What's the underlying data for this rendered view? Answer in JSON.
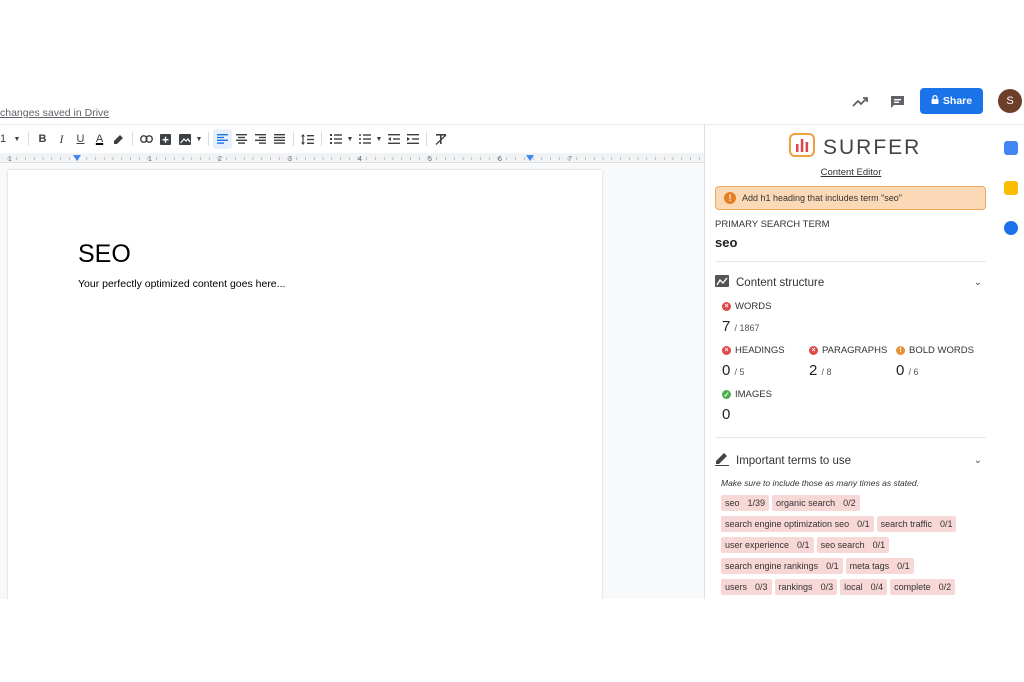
{
  "topbar": {
    "saved_text": "changes saved in Drive",
    "share_label": "Share",
    "avatar_initial": "S"
  },
  "toolbar": {
    "zoom_fragment": "1",
    "bold": "B",
    "italic": "I",
    "underline": "U",
    "text_color": "A"
  },
  "ruler": {
    "marks": [
      "1",
      "1",
      "2",
      "3",
      "4",
      "5",
      "6",
      "7"
    ]
  },
  "document": {
    "title": "SEO",
    "body": "Your perfectly optimized content goes here..."
  },
  "surfer": {
    "logo_text": "SURFER",
    "content_editor_link": "Content Editor",
    "alert": "Add h1 heading that includes term \"seo\"",
    "primary_search_term_label": "PRIMARY SEARCH TERM",
    "primary_search_term": "seo",
    "content_structure": {
      "title": "Content structure",
      "words": {
        "label": "WORDS",
        "value": "7",
        "target": "/ 1867",
        "status": "red"
      },
      "headings": {
        "label": "HEADINGS",
        "value": "0",
        "target": "/ 5",
        "status": "red"
      },
      "paragraphs": {
        "label": "PARAGRAPHS",
        "value": "2",
        "target": "/ 8",
        "status": "red"
      },
      "bold_words": {
        "label": "BOLD WORDS",
        "value": "0",
        "target": "/ 6",
        "status": "orange"
      },
      "images": {
        "label": "IMAGES",
        "value": "0",
        "status": "green"
      }
    },
    "important_terms": {
      "title": "Important terms to use",
      "hint": "Make sure to include those as many times as stated.",
      "rows": [
        [
          {
            "term": "seo",
            "count": "1/39"
          },
          {
            "term": "organic search",
            "count": "0/2"
          }
        ],
        [
          {
            "term": "search engine optimization seo",
            "count": "0/1"
          },
          {
            "term": "search traffic",
            "count": "0/1"
          }
        ],
        [
          {
            "term": "user experience",
            "count": "0/1"
          },
          {
            "term": "seo search",
            "count": "0/1"
          }
        ],
        [
          {
            "term": "search engine rankings",
            "count": "0/1"
          },
          {
            "term": "meta tags",
            "count": "0/1"
          }
        ],
        [
          {
            "term": "users",
            "count": "0/3"
          },
          {
            "term": "rankings",
            "count": "0/3"
          },
          {
            "term": "local",
            "count": "0/4"
          },
          {
            "term": "complete",
            "count": "0/2"
          }
        ]
      ]
    }
  },
  "colors": {
    "share_blue": "#1a73e8",
    "alert_bg": "#fcd9b6",
    "term_bg": "#f8d7d7",
    "status_red": "#e04848",
    "status_orange": "#e69138",
    "status_green": "#4caf50"
  }
}
